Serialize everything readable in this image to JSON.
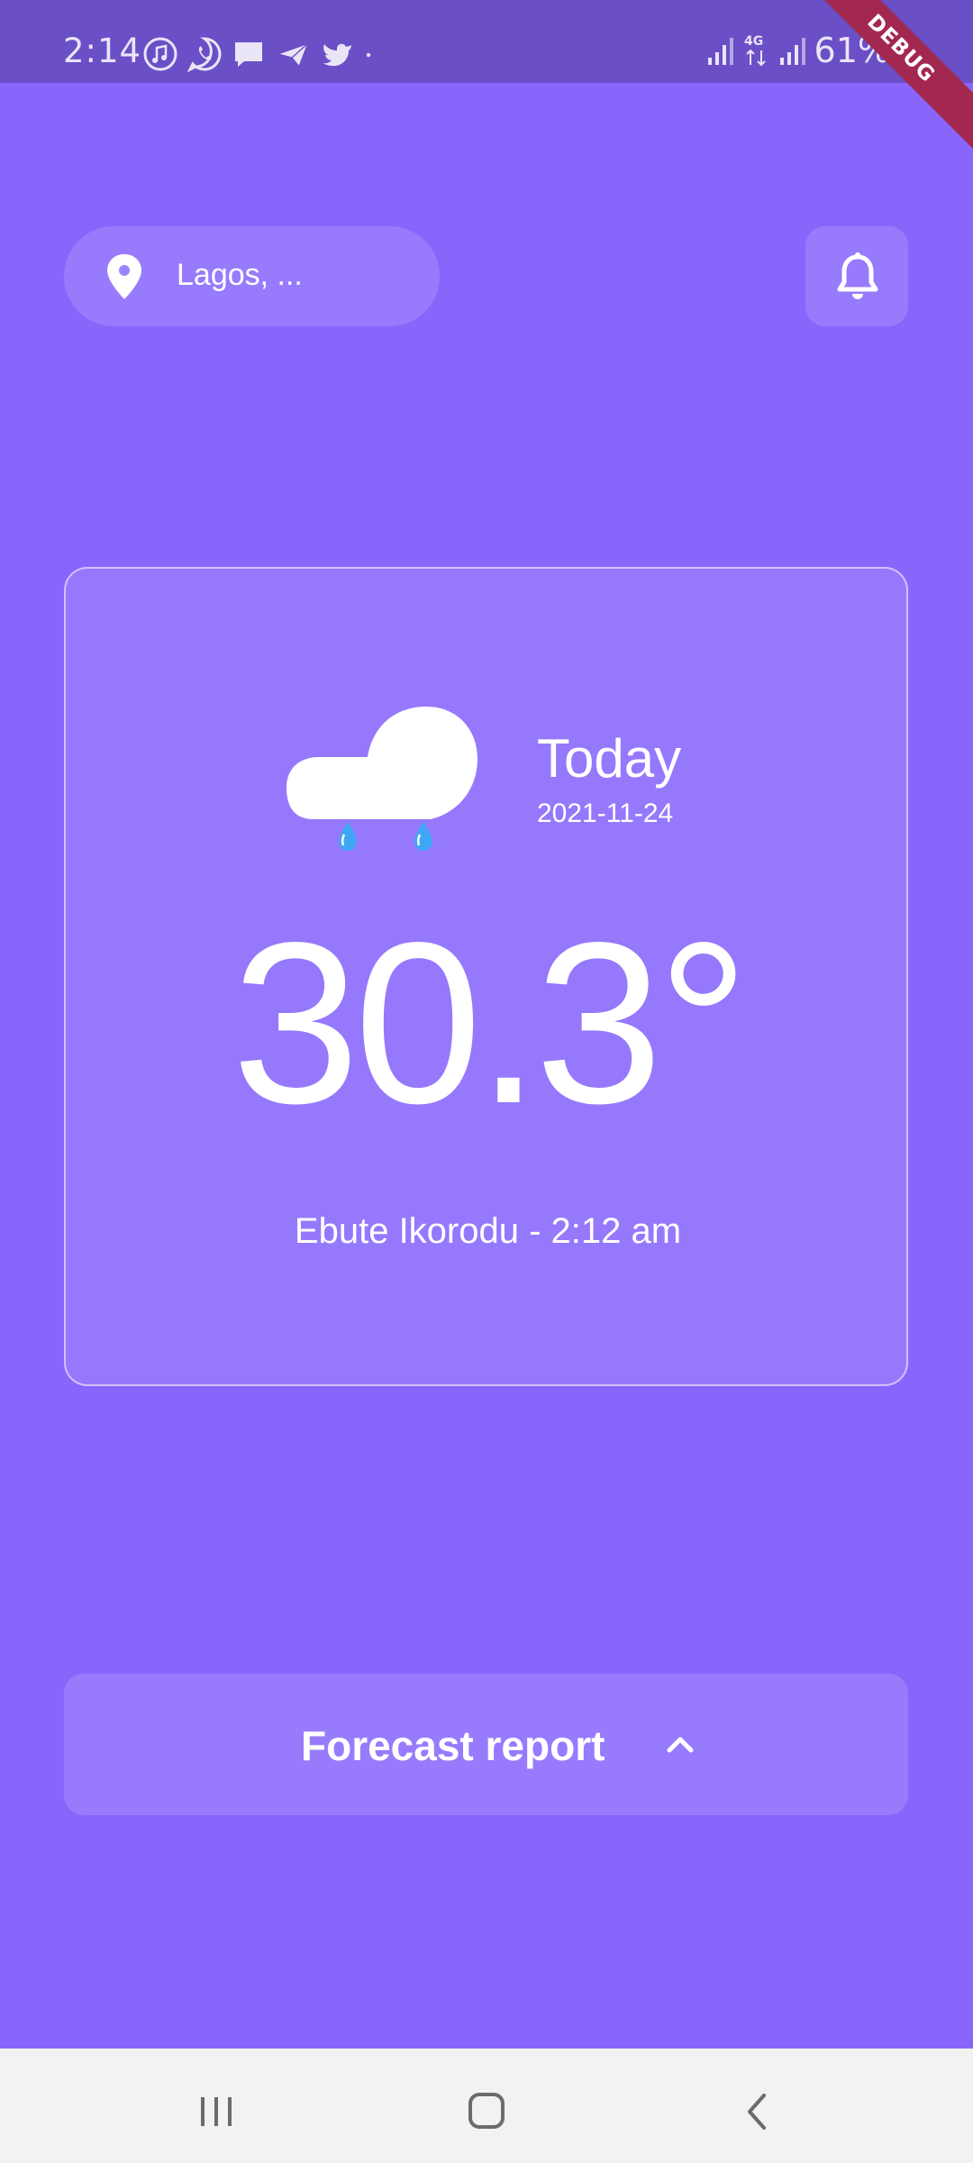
{
  "status_bar": {
    "time": "2:14",
    "notification_icons": [
      "music-icon",
      "whatsapp-icon",
      "message-icon",
      "send-icon",
      "twitter-icon",
      "dot-icon"
    ],
    "battery": "61%",
    "network": "4G"
  },
  "debug_banner": "DEBUG",
  "header": {
    "location": "Lagos, ...",
    "location_icon": "location-pin-icon",
    "notification_icon": "bell-icon"
  },
  "weather": {
    "condition_icon": "cloud-rain-icon",
    "day_label": "Today",
    "date": "2021-11-24",
    "temperature": "30.3°",
    "location_time": "Ebute Ikorodu - 2:12 am"
  },
  "forecast": {
    "label": "Forecast report",
    "icon": "chevron-up-icon"
  },
  "nav": {
    "items": [
      "recent-apps-icon",
      "home-icon",
      "back-icon"
    ]
  },
  "colors": {
    "background": "#8866fc",
    "status_bar": "#6a4fc6",
    "raindrop": "#3fa6f5",
    "debug": "#a3284f"
  }
}
